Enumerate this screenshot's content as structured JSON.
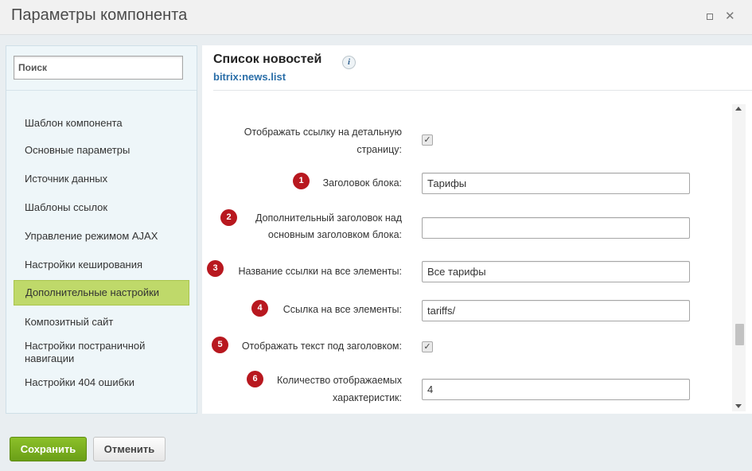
{
  "window": {
    "title": "Параметры компонента",
    "max_icon": "maximize-icon",
    "close_icon": "close-icon"
  },
  "sidebar": {
    "search_placeholder": "Поиск",
    "items": [
      {
        "label": "Шаблон компонента",
        "active": false
      },
      {
        "label": "Основные параметры",
        "active": false
      },
      {
        "label": "Источник данных",
        "active": false
      },
      {
        "label": "Шаблоны ссылок",
        "active": false
      },
      {
        "label": "Управление режимом AJAX",
        "active": false
      },
      {
        "label": "Настройки кеширования",
        "active": false
      },
      {
        "label": "Дополнительные настройки",
        "active": true
      },
      {
        "label": "Композитный сайт",
        "active": false
      },
      {
        "label": "Настройки постраничной навигации",
        "active": false
      },
      {
        "label": "Настройки 404 ошибки",
        "active": false
      }
    ]
  },
  "main": {
    "title": "Список новостей",
    "subtitle": "bitrix:news.list",
    "info_icon": "info-icon",
    "fields": [
      {
        "label": "Отображать ссылку на детальную страницу:",
        "type": "checkbox",
        "checked": true
      },
      {
        "badge": "1",
        "label": "Заголовок блока:",
        "type": "text",
        "value": "Тарифы"
      },
      {
        "badge": "2",
        "label": "Дополнительный заголовок над основным заголовком блока:",
        "type": "text",
        "value": ""
      },
      {
        "badge": "3",
        "label": "Название ссылки на все элементы:",
        "type": "text",
        "value": "Все тарифы"
      },
      {
        "badge": "4",
        "label": "Ссылка на все элементы:",
        "type": "text",
        "value": "tariffs/"
      },
      {
        "badge": "5",
        "label": "Отображать текст под заголовком:",
        "type": "checkbox",
        "checked": true
      },
      {
        "badge": "6",
        "label": "Количество отображаемых характеристик:",
        "type": "text",
        "value": "4"
      }
    ]
  },
  "footer": {
    "save_label": "Сохранить",
    "cancel_label": "Отменить"
  },
  "colors": {
    "accent_green": "#7fb11e",
    "active_item": "#bfd96a",
    "badge_red": "#b8181f",
    "link_blue": "#2a6ea8"
  }
}
